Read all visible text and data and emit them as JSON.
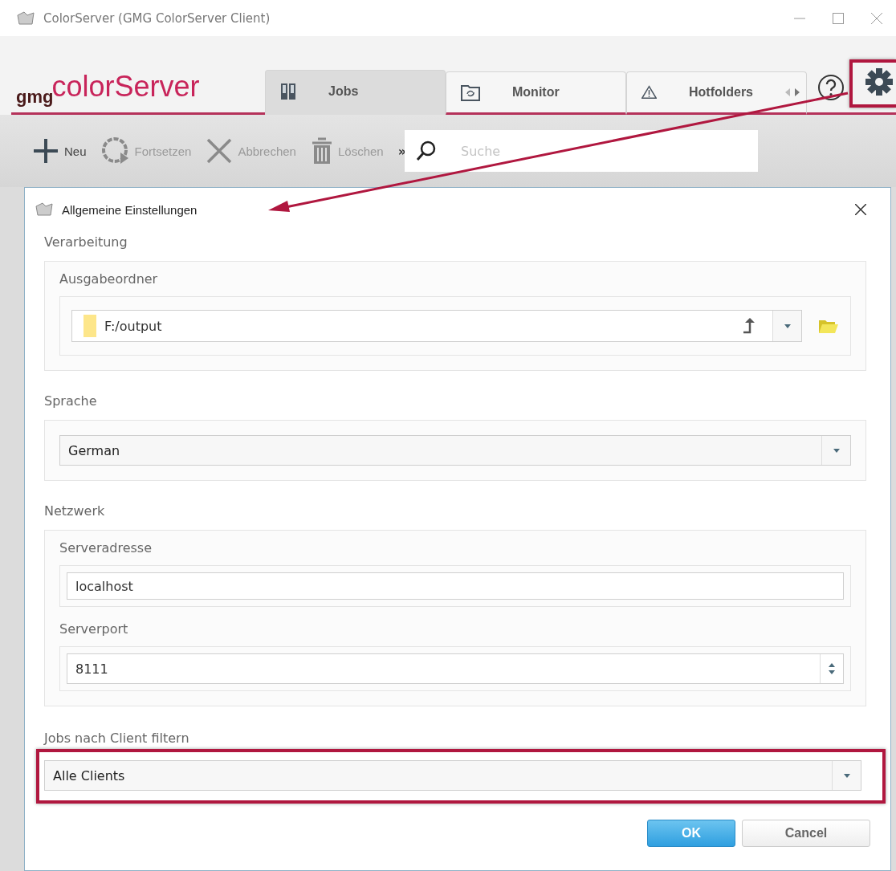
{
  "window": {
    "title": "ColorServer (GMG ColorServer Client)"
  },
  "logo": {
    "prefix": "gmg",
    "name": "colorServer"
  },
  "tabs": [
    {
      "label": "Jobs",
      "kind": "jobs",
      "selected": true
    },
    {
      "label": "Monitor",
      "kind": "monitor",
      "selected": false
    },
    {
      "label": "Hotfolders",
      "kind": "warning",
      "selected": false
    }
  ],
  "toolbar": {
    "items": [
      {
        "label": "Neu",
        "kind": "plus",
        "disabled": false
      },
      {
        "label": "Fortsetzen",
        "kind": "resume",
        "disabled": true
      },
      {
        "label": "Abbrechen",
        "kind": "cancel",
        "disabled": true
      },
      {
        "label": "Löschen",
        "kind": "trash",
        "disabled": true
      }
    ],
    "overflow": "»",
    "search": {
      "placeholder": "Suche"
    }
  },
  "dialog": {
    "title": "Allgemeine Einstellungen",
    "processing": {
      "title": "Verarbeitung",
      "output_folder": {
        "label": "Ausgabeordner",
        "value": "F:/output"
      }
    },
    "language": {
      "label": "Sprache",
      "value": "German"
    },
    "network": {
      "title": "Netzwerk",
      "server_address": {
        "label": "Serveradresse",
        "value": "localhost"
      },
      "server_port": {
        "label": "Serverport",
        "value": "8111"
      }
    },
    "client_filter": {
      "label": "Jobs nach Client filtern",
      "value": "Alle Clients"
    },
    "buttons": [
      {
        "label": "OK",
        "kind": "primary"
      },
      {
        "label": "Cancel",
        "kind": "secondary"
      }
    ]
  }
}
